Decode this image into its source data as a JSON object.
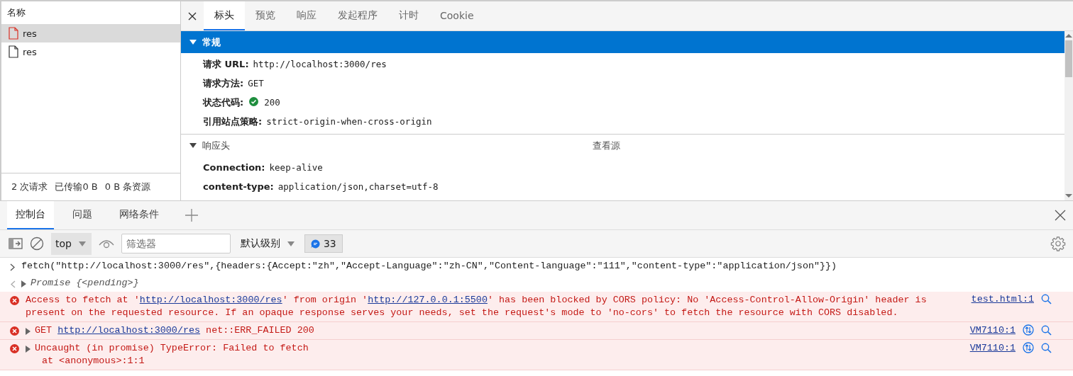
{
  "requests": {
    "header": "名称",
    "items": [
      {
        "name": "res",
        "selected": true,
        "failed": true
      },
      {
        "name": "res",
        "selected": false,
        "failed": false
      }
    ],
    "summary": [
      "2 次请求",
      "已传输0 B",
      "0 B 条资源"
    ]
  },
  "detail": {
    "tabs": [
      {
        "label": "标头",
        "selected": true
      },
      {
        "label": "预览",
        "selected": false
      },
      {
        "label": "响应",
        "selected": false
      },
      {
        "label": "发起程序",
        "selected": false
      },
      {
        "label": "计时",
        "selected": false
      },
      {
        "label": "Cookie",
        "selected": false
      }
    ],
    "sections": [
      {
        "title": "常规",
        "expanded": true,
        "highlighted": true,
        "rows": [
          {
            "label": "请求 URL:",
            "value": "http://localhost:3000/res",
            "ok": false
          },
          {
            "label": "请求方法:",
            "value": "GET",
            "ok": false
          },
          {
            "label": "状态代码:",
            "value": "200",
            "ok": true
          },
          {
            "label": "引用站点策略:",
            "value": "strict-origin-when-cross-origin",
            "ok": false
          }
        ]
      },
      {
        "title": "响应头",
        "expanded": true,
        "highlighted": false,
        "link": "查看源",
        "rows": [
          {
            "label": "Connection:",
            "value": "keep-alive",
            "ok": false
          },
          {
            "label": "content-type:",
            "value": "application/json,charset=utf-8",
            "ok": false
          }
        ]
      }
    ]
  },
  "drawer": {
    "tabs": [
      {
        "label": "控制台",
        "selected": true
      },
      {
        "label": "问题",
        "selected": false
      },
      {
        "label": "网络条件",
        "selected": false
      }
    ],
    "context": "top",
    "filter": {
      "placeholder": "筛选器"
    },
    "level": "默认级别",
    "message_count": "33"
  },
  "console": [
    {
      "kind": "input",
      "parts": [
        {
          "text": "fetch(\"http://localhost:3000/res\",{headers:{Accept:\"zh\",\"Accept-Language\":\"zh-CN\",\"Content-language\":\"111\",\"content-type\":\"application/json\"}})",
          "link": false
        }
      ]
    },
    {
      "kind": "result",
      "parts": [
        {
          "text": "Promise {<pending>}",
          "link": false
        }
      ]
    },
    {
      "kind": "error",
      "expandable": false,
      "parts": [
        {
          "text": "Access to fetch at '",
          "link": false
        },
        {
          "text": "http://localhost:3000/res",
          "link": true
        },
        {
          "text": "' from origin '",
          "link": false
        },
        {
          "text": "http://127.0.0.1:5500",
          "link": true
        },
        {
          "text": "' has been blocked by CORS policy: No 'Access-Control-Allow-Origin' header is present on the requested resource. If an opaque response serves your needs, set the request's mode to 'no-cors' to fetch the resource with CORS disabled.",
          "link": false
        }
      ],
      "source": "test.html:1",
      "network": false
    },
    {
      "kind": "error",
      "expandable": true,
      "parts": [
        {
          "text": "GET ",
          "link": false
        },
        {
          "text": "http://localhost:3000/res",
          "link": true
        },
        {
          "text": " net::ERR_FAILED 200",
          "link": false
        }
      ],
      "source": "VM7110:1",
      "network": true
    },
    {
      "kind": "error",
      "expandable": true,
      "parts": [
        {
          "text": "Uncaught (in promise) TypeError: Failed to fetch",
          "link": false
        }
      ],
      "stack": [
        "at <anonymous>:1:1"
      ],
      "source": "VM7110:1",
      "network": true
    }
  ]
}
